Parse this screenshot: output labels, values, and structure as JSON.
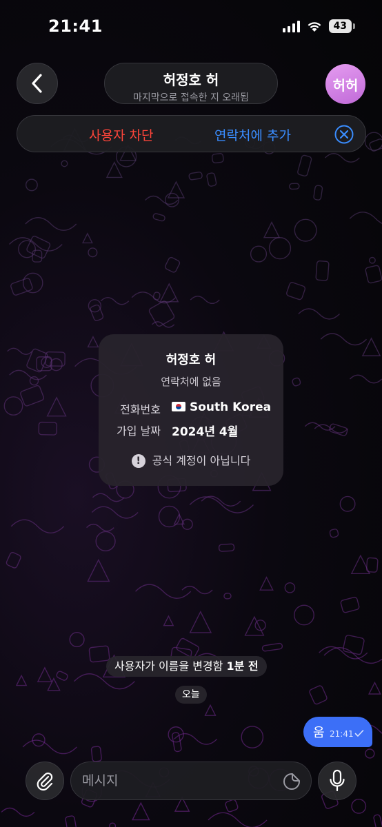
{
  "status_bar": {
    "time": "21:41",
    "battery": "43",
    "icons": [
      "signal-icon",
      "wifi-icon",
      "battery-icon"
    ]
  },
  "header": {
    "back_icon": "chevron-left-icon",
    "title": "허정호 허",
    "subtitle": "마지막으로 접속한 지 오래됨",
    "avatar_initials": "허허",
    "avatar_color": "#d884e8"
  },
  "action_bar": {
    "block_label": "사용자 차단",
    "add_contact_label": "연락처에 추가",
    "close_icon": "close-circle-icon"
  },
  "info_card": {
    "name": "허정호 허",
    "subtitle": "연락처에 없음",
    "phone_label": "전화번호",
    "phone_value": "South Korea",
    "joined_label": "가입 날짜",
    "joined_value": "2024년 4월",
    "official_text": "공식 계정이 아닙니다",
    "official_icon": "warning-icon"
  },
  "service": {
    "name_change_text": "사용자가 이름을 변경함 ",
    "name_change_time": "1분 전",
    "date_label": "오늘"
  },
  "message": {
    "text": "움",
    "time": "21:41",
    "status_icon": "check-icon",
    "bubble_color": "#3c6ff7"
  },
  "composer": {
    "placeholder": "메시지",
    "attach_icon": "paperclip-icon",
    "sticker_icon": "sticker-icon",
    "mic_icon": "microphone-icon"
  },
  "colors": {
    "accent": "#3a8dff",
    "danger": "#ff453a"
  }
}
